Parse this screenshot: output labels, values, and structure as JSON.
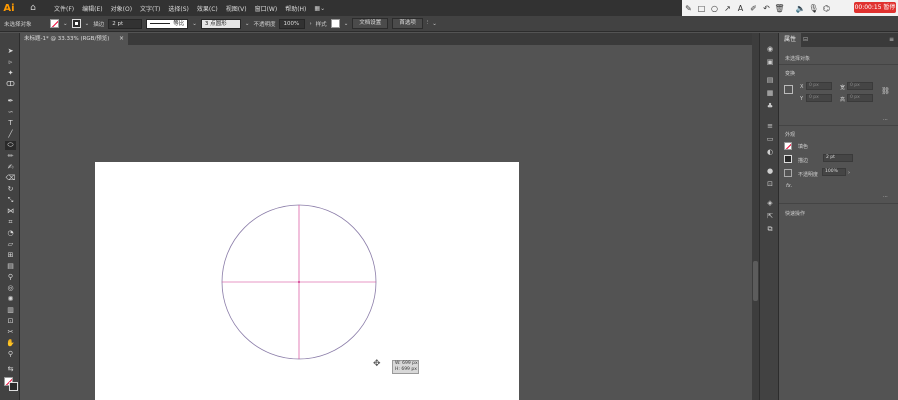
{
  "app": {
    "logo": "Ai"
  },
  "menu": [
    "文件(F)",
    "编辑(E)",
    "对象(O)",
    "文字(T)",
    "选择(S)",
    "效果(C)",
    "视图(V)",
    "窗口(W)",
    "帮助(H)"
  ],
  "recorder": {
    "timer": "00:00:15 暂停"
  },
  "control_bar": {
    "selection_label": "未选择对象",
    "stroke_label": "描边",
    "stroke_weight": "2 pt",
    "stroke_profile": "等比",
    "brush": "3 点圆形",
    "opacity_label": "不透明度",
    "opacity_value": "100%",
    "style_label": "样式",
    "doc_setup_button": "文档设置",
    "preferences_button": "首选项"
  },
  "document_tab": {
    "title": "未标题-1* @ 33.33% (RGB/预览)",
    "close": "×"
  },
  "selection_tooltip": {
    "w": "W: 699 px",
    "h": "H: 699 px"
  },
  "properties_panel": {
    "tab_properties": "属性",
    "no_selection": "未选择对象",
    "transform_heading": "变换",
    "x_label": "X",
    "y_label": "Y",
    "w_label": "宽",
    "h_label": "高",
    "x_value": "0 px",
    "y_value": "0 px",
    "w_value": "0 px",
    "h_value": "0 px",
    "appearance_heading": "外观",
    "fill_label": "填色",
    "stroke_label": "描边",
    "stroke_value": "2 pt",
    "opacity_label": "不透明度",
    "opacity_value": "100%",
    "fx_label": "fx.",
    "quick_actions_heading": "快速操作"
  },
  "colors": {
    "accent": "#ff9a00",
    "guide": "#d0308a",
    "circle": "#8a7ca8",
    "timer": "#e0312e"
  }
}
